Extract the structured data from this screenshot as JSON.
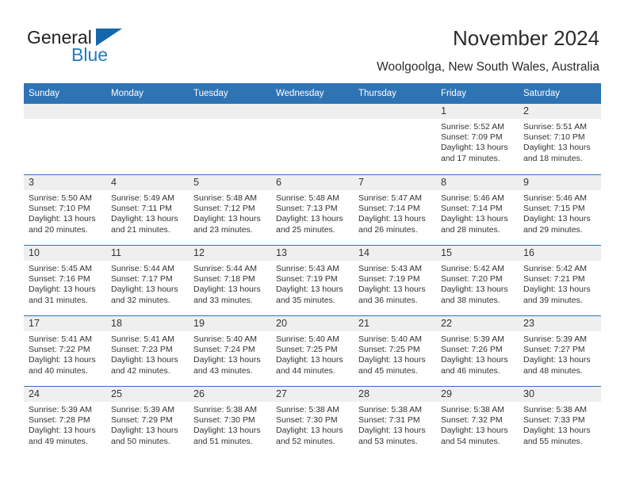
{
  "brand": {
    "name_part1": "General",
    "name_part2": "Blue",
    "accent_color": "#1f7bc1",
    "logo_triangle_color": "#1567ad"
  },
  "header": {
    "title": "November 2024",
    "subtitle": "Woolgoolga, New South Wales, Australia",
    "header_bg_color": "#2e73b4",
    "daynum_band_color": "#efefef"
  },
  "calendar": {
    "weekday_headers": [
      "Sunday",
      "Monday",
      "Tuesday",
      "Wednesday",
      "Thursday",
      "Friday",
      "Saturday"
    ],
    "labels": {
      "sunrise": "Sunrise:",
      "sunset": "Sunset:",
      "daylight": "Daylight:"
    },
    "weeks": [
      [
        {
          "day": "",
          "empty": true
        },
        {
          "day": "",
          "empty": true
        },
        {
          "day": "",
          "empty": true
        },
        {
          "day": "",
          "empty": true
        },
        {
          "day": "",
          "empty": true
        },
        {
          "day": "1",
          "sunrise": "Sunrise: 5:52 AM",
          "sunset": "Sunset: 7:09 PM",
          "daylight_l1": "Daylight: 13 hours",
          "daylight_l2": "and 17 minutes."
        },
        {
          "day": "2",
          "sunrise": "Sunrise: 5:51 AM",
          "sunset": "Sunset: 7:10 PM",
          "daylight_l1": "Daylight: 13 hours",
          "daylight_l2": "and 18 minutes."
        }
      ],
      [
        {
          "day": "3",
          "sunrise": "Sunrise: 5:50 AM",
          "sunset": "Sunset: 7:10 PM",
          "daylight_l1": "Daylight: 13 hours",
          "daylight_l2": "and 20 minutes."
        },
        {
          "day": "4",
          "sunrise": "Sunrise: 5:49 AM",
          "sunset": "Sunset: 7:11 PM",
          "daylight_l1": "Daylight: 13 hours",
          "daylight_l2": "and 21 minutes."
        },
        {
          "day": "5",
          "sunrise": "Sunrise: 5:48 AM",
          "sunset": "Sunset: 7:12 PM",
          "daylight_l1": "Daylight: 13 hours",
          "daylight_l2": "and 23 minutes."
        },
        {
          "day": "6",
          "sunrise": "Sunrise: 5:48 AM",
          "sunset": "Sunset: 7:13 PM",
          "daylight_l1": "Daylight: 13 hours",
          "daylight_l2": "and 25 minutes."
        },
        {
          "day": "7",
          "sunrise": "Sunrise: 5:47 AM",
          "sunset": "Sunset: 7:14 PM",
          "daylight_l1": "Daylight: 13 hours",
          "daylight_l2": "and 26 minutes."
        },
        {
          "day": "8",
          "sunrise": "Sunrise: 5:46 AM",
          "sunset": "Sunset: 7:14 PM",
          "daylight_l1": "Daylight: 13 hours",
          "daylight_l2": "and 28 minutes."
        },
        {
          "day": "9",
          "sunrise": "Sunrise: 5:46 AM",
          "sunset": "Sunset: 7:15 PM",
          "daylight_l1": "Daylight: 13 hours",
          "daylight_l2": "and 29 minutes."
        }
      ],
      [
        {
          "day": "10",
          "sunrise": "Sunrise: 5:45 AM",
          "sunset": "Sunset: 7:16 PM",
          "daylight_l1": "Daylight: 13 hours",
          "daylight_l2": "and 31 minutes."
        },
        {
          "day": "11",
          "sunrise": "Sunrise: 5:44 AM",
          "sunset": "Sunset: 7:17 PM",
          "daylight_l1": "Daylight: 13 hours",
          "daylight_l2": "and 32 minutes."
        },
        {
          "day": "12",
          "sunrise": "Sunrise: 5:44 AM",
          "sunset": "Sunset: 7:18 PM",
          "daylight_l1": "Daylight: 13 hours",
          "daylight_l2": "and 33 minutes."
        },
        {
          "day": "13",
          "sunrise": "Sunrise: 5:43 AM",
          "sunset": "Sunset: 7:19 PM",
          "daylight_l1": "Daylight: 13 hours",
          "daylight_l2": "and 35 minutes."
        },
        {
          "day": "14",
          "sunrise": "Sunrise: 5:43 AM",
          "sunset": "Sunset: 7:19 PM",
          "daylight_l1": "Daylight: 13 hours",
          "daylight_l2": "and 36 minutes."
        },
        {
          "day": "15",
          "sunrise": "Sunrise: 5:42 AM",
          "sunset": "Sunset: 7:20 PM",
          "daylight_l1": "Daylight: 13 hours",
          "daylight_l2": "and 38 minutes."
        },
        {
          "day": "16",
          "sunrise": "Sunrise: 5:42 AM",
          "sunset": "Sunset: 7:21 PM",
          "daylight_l1": "Daylight: 13 hours",
          "daylight_l2": "and 39 minutes."
        }
      ],
      [
        {
          "day": "17",
          "sunrise": "Sunrise: 5:41 AM",
          "sunset": "Sunset: 7:22 PM",
          "daylight_l1": "Daylight: 13 hours",
          "daylight_l2": "and 40 minutes."
        },
        {
          "day": "18",
          "sunrise": "Sunrise: 5:41 AM",
          "sunset": "Sunset: 7:23 PM",
          "daylight_l1": "Daylight: 13 hours",
          "daylight_l2": "and 42 minutes."
        },
        {
          "day": "19",
          "sunrise": "Sunrise: 5:40 AM",
          "sunset": "Sunset: 7:24 PM",
          "daylight_l1": "Daylight: 13 hours",
          "daylight_l2": "and 43 minutes."
        },
        {
          "day": "20",
          "sunrise": "Sunrise: 5:40 AM",
          "sunset": "Sunset: 7:25 PM",
          "daylight_l1": "Daylight: 13 hours",
          "daylight_l2": "and 44 minutes."
        },
        {
          "day": "21",
          "sunrise": "Sunrise: 5:40 AM",
          "sunset": "Sunset: 7:25 PM",
          "daylight_l1": "Daylight: 13 hours",
          "daylight_l2": "and 45 minutes."
        },
        {
          "day": "22",
          "sunrise": "Sunrise: 5:39 AM",
          "sunset": "Sunset: 7:26 PM",
          "daylight_l1": "Daylight: 13 hours",
          "daylight_l2": "and 46 minutes."
        },
        {
          "day": "23",
          "sunrise": "Sunrise: 5:39 AM",
          "sunset": "Sunset: 7:27 PM",
          "daylight_l1": "Daylight: 13 hours",
          "daylight_l2": "and 48 minutes."
        }
      ],
      [
        {
          "day": "24",
          "sunrise": "Sunrise: 5:39 AM",
          "sunset": "Sunset: 7:28 PM",
          "daylight_l1": "Daylight: 13 hours",
          "daylight_l2": "and 49 minutes."
        },
        {
          "day": "25",
          "sunrise": "Sunrise: 5:39 AM",
          "sunset": "Sunset: 7:29 PM",
          "daylight_l1": "Daylight: 13 hours",
          "daylight_l2": "and 50 minutes."
        },
        {
          "day": "26",
          "sunrise": "Sunrise: 5:38 AM",
          "sunset": "Sunset: 7:30 PM",
          "daylight_l1": "Daylight: 13 hours",
          "daylight_l2": "and 51 minutes."
        },
        {
          "day": "27",
          "sunrise": "Sunrise: 5:38 AM",
          "sunset": "Sunset: 7:30 PM",
          "daylight_l1": "Daylight: 13 hours",
          "daylight_l2": "and 52 minutes."
        },
        {
          "day": "28",
          "sunrise": "Sunrise: 5:38 AM",
          "sunset": "Sunset: 7:31 PM",
          "daylight_l1": "Daylight: 13 hours",
          "daylight_l2": "and 53 minutes."
        },
        {
          "day": "29",
          "sunrise": "Sunrise: 5:38 AM",
          "sunset": "Sunset: 7:32 PM",
          "daylight_l1": "Daylight: 13 hours",
          "daylight_l2": "and 54 minutes."
        },
        {
          "day": "30",
          "sunrise": "Sunrise: 5:38 AM",
          "sunset": "Sunset: 7:33 PM",
          "daylight_l1": "Daylight: 13 hours",
          "daylight_l2": "and 55 minutes."
        }
      ]
    ]
  }
}
